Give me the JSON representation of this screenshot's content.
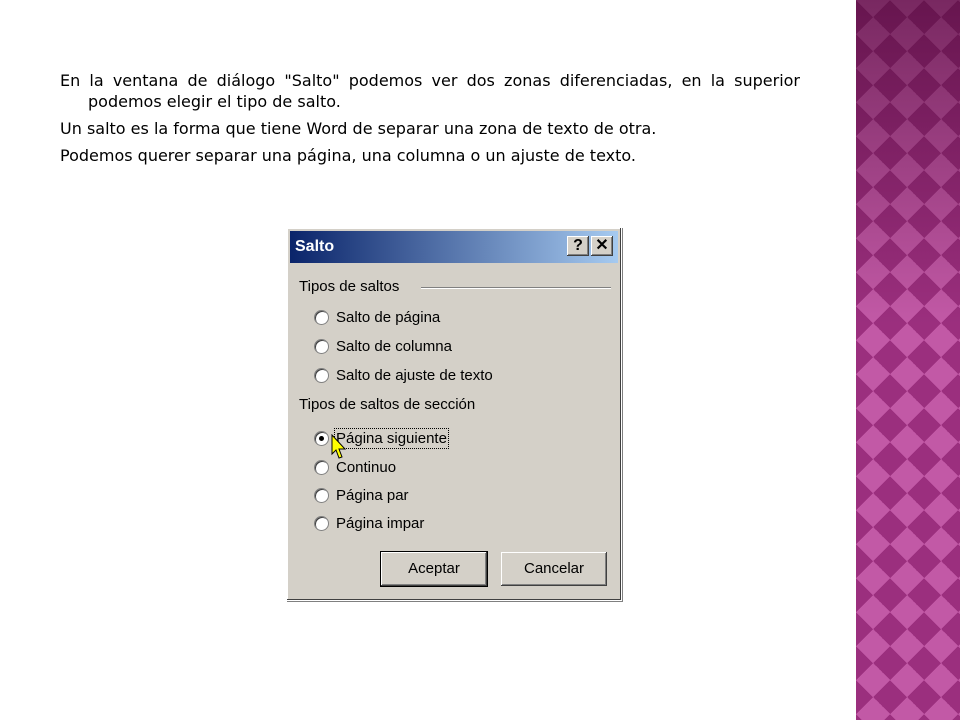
{
  "text": {
    "p1": "En la ventana de diálogo \"Salto\" podemos ver dos zonas diferenciadas, en la superior podemos elegir el tipo de salto.",
    "p2": "Un salto es la forma que tiene Word de separar una zona de texto de otra.",
    "p3": "Podemos querer separar una página, una columna o un ajuste de texto."
  },
  "dialog": {
    "title": "Salto",
    "help_label": "?",
    "close_label": "✕",
    "group1": {
      "label": "Tipos de saltos",
      "options": [
        "Salto de página",
        "Salto de columna",
        "Salto de ajuste de texto"
      ]
    },
    "group2": {
      "label": "Tipos de saltos de sección",
      "options": [
        "Página siguiente",
        "Continuo",
        "Página par",
        "Página impar"
      ],
      "selected": "Página siguiente"
    },
    "ok_label": "Aceptar",
    "cancel_label": "Cancelar"
  },
  "icons": {
    "cursor": "mouse-pointer-icon"
  },
  "colors": {
    "titlebar_start": "#0a246a",
    "titlebar_end": "#a6caf0",
    "dialog_bg": "#d4d0c8",
    "side_panel": "#9b2f7e",
    "cursor": "#ffff00"
  }
}
